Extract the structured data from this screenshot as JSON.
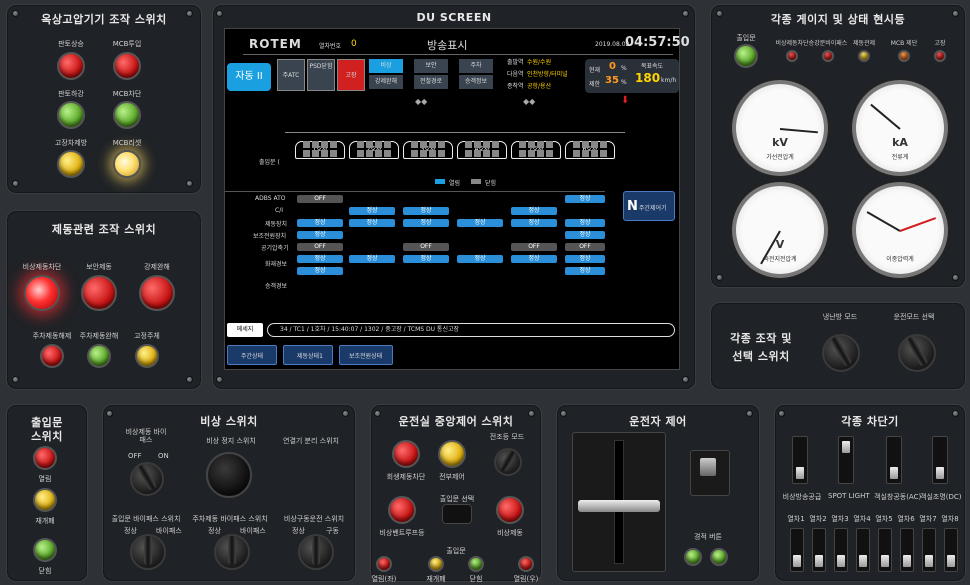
{
  "p1": {
    "title": "옥상고압기기 조작 스위치",
    "labels": [
      "판토상승",
      "MCB투입",
      "판토하강",
      "MCB차단",
      "고장차제방",
      "MCB리셋"
    ]
  },
  "p2": {
    "title": "제동관련 조작 스위치",
    "labels": [
      "비상제동차단",
      "보안제동",
      "강제완해",
      "주차제동해제",
      "주차제동완해",
      "고정주체"
    ]
  },
  "du": {
    "title": "DU SCREEN",
    "logo": "ROTEM",
    "train_label": "열차번호",
    "train_no": "0",
    "broadcast": "방송표시",
    "date": "2019.08.02",
    "time": "04:57:50",
    "mode": "자동 II",
    "btns": [
      "주ATC",
      "PSD닫힘",
      "고장"
    ],
    "center_btns": [
      "비상",
      "보안",
      "주차",
      "강제완해",
      "전철경로",
      "승객정보"
    ],
    "stations": {
      "a_label": "출발역",
      "a": "수원/수원",
      "b_label": "다음역",
      "b": "인천방향/터미널",
      "c_label": "종착역",
      "c": "공항/용산"
    },
    "speed_cur_label": "현재",
    "speed_cur": "0",
    "speed_unit": "%",
    "target_label": "제한",
    "target": "35",
    "target_unit": "%",
    "limit_label": "목표속도",
    "limit": "180",
    "limit_unit": "km/h",
    "cars": [
      "1호차",
      "2호차",
      "3호차",
      "4호차",
      "7호차",
      "6호차"
    ],
    "door_label": "출입문 (",
    "door_legend": [
      "열림",
      "닫힘"
    ],
    "rows": [
      "ADBS ATO",
      "C/I",
      "제동장치",
      "보조전원장치",
      "공기압축기",
      "화재경보",
      "승객경보"
    ],
    "side_btn": "주간제어기",
    "msg_label": "메세지",
    "msg": "34 / TC1 / 1호차 / 15:40:07 / 1302 / 중고장 / TCMS DU 통신고장",
    "bottom_btns": [
      "주간상태",
      "제동상태1",
      "보조전원상태"
    ],
    "off": "OFF",
    "normal": "정상"
  },
  "p3": {
    "title": "각종 게이지 및 상태 현시등",
    "lamps": [
      "출입문",
      "비상제동차단",
      "승강문비이패스",
      "제동관제",
      "MCB 제단",
      "고장"
    ],
    "gauges": [
      {
        "unit": "kV",
        "sub": "가선전압계",
        "value": 25
      },
      {
        "unit": "kA",
        "sub": "전류계",
        "value": 0.7
      },
      {
        "unit": "V",
        "sub": "축전지전압계",
        "value": 0
      },
      {
        "unit": "",
        "sub": "이중압력계",
        "value": 0
      }
    ]
  },
  "p4": {
    "title": "각종 조작 및",
    "title2": "선택 스위치",
    "sw1": "냉난방 모드",
    "sw2": "운전모드 선택"
  },
  "p5": {
    "title": "출입문",
    "title2": "스위치",
    "labels": [
      "열림",
      "재개폐",
      "닫힘"
    ]
  },
  "p6": {
    "title": "비상 스위치",
    "bypass": "비상제동 바이패스",
    "bypass_off": "OFF",
    "bypass_on": "ON",
    "l1": "비상 정지 스위치",
    "l2": "연결기 분리 스위치",
    "s1": "출입문 바이패스 스위치",
    "s2": "주차제동 바이패스 스위치",
    "s3": "비상구동운전 스위치",
    "s1a": "정상",
    "s1b": "바이패스",
    "s2a": "정상",
    "s2b": "바이패스",
    "s3a": "정상",
    "s3b": "구동"
  },
  "p7": {
    "title": "운전실 중앙제어 스위치",
    "l1": "회생제동차단",
    "l2": "전부제어",
    "mode": "전조등 모드",
    "sel": "출입문 선택",
    "l3": "비상벤트루프등",
    "l4": "비상제동",
    "door": "출입문",
    "d": [
      "열림(좌)",
      "재개폐",
      "닫힘",
      "열림(우)"
    ]
  },
  "p8": {
    "title": "운전자 제어",
    "horn": "경적 버튼"
  },
  "p9": {
    "title": "각종 차단기",
    "bl": [
      "비상방송공급",
      "SPOT LIGHT",
      "객실창공동(AC)",
      "객실조명(DC)"
    ],
    "cars": [
      "열차1",
      "열차2",
      "열차3",
      "열차4",
      "열차5",
      "열차6",
      "열차7",
      "열차8"
    ]
  }
}
